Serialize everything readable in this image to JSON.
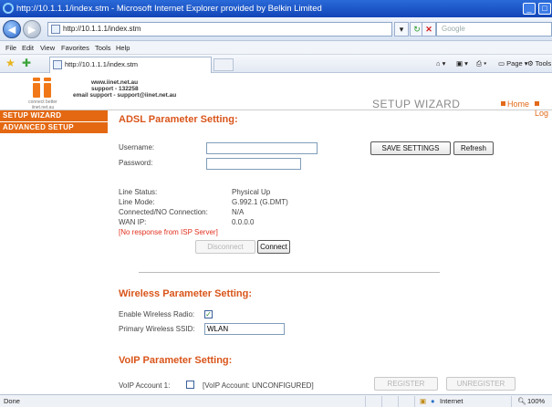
{
  "window": {
    "title": "http://10.1.1.1/index.stm - Microsoft Internet Explorer provided by Belkin Limited",
    "controls": [
      "_",
      "□"
    ]
  },
  "browser": {
    "address": "http://10.1.1.1/index.stm",
    "search_placeholder": "Google",
    "menu": [
      "File",
      "Edit",
      "View",
      "Favorites",
      "Tools",
      "Help"
    ],
    "tab_title": "http://10.1.1.1/index.stm",
    "commands": {
      "page": "Page",
      "tools": "Tools"
    },
    "status_left": "Done",
    "zone": "Internet",
    "zoom": "100%"
  },
  "header": {
    "logo_tagline_1": "connect better",
    "logo_tagline_2": "iinet.net.au",
    "site": "www.iinet.net.au",
    "support": "support - 132258",
    "email": "email support - support@iinet.net.au",
    "wizard_title": "SETUP WIZARD",
    "home_link": "Home",
    "logout_link": "Log"
  },
  "sidebar": {
    "items": [
      "SETUP WIZARD",
      "ADVANCED SETUP"
    ]
  },
  "adsl": {
    "heading": "ADSL Parameter Setting:",
    "username_label": "Username:",
    "password_label": "Password:",
    "username_value": "",
    "password_value": "",
    "save_button": "SAVE SETTINGS",
    "refresh_button": "Refresh",
    "status_rows": [
      {
        "label": "Line Status:",
        "value": "Physical Up"
      },
      {
        "label": "Line Mode:",
        "value": "G.992.1 (G.DMT)"
      },
      {
        "label": "Connected/NO Connection:",
        "value": "N/A"
      },
      {
        "label": "WAN IP:",
        "value": "0.0.0.0"
      }
    ],
    "error": "[No response from ISP Server]",
    "disconnect_button": "Disconnect",
    "connect_button": "Connect"
  },
  "wireless": {
    "heading": "Wireless Parameter Setting:",
    "enable_label": "Enable Wireless Radio:",
    "enable_checked": "✓",
    "ssid_label": "Primary Wireless SSID:",
    "ssid_value": "WLAN"
  },
  "voip": {
    "heading": "VoIP Parameter Setting:",
    "account_label": "VoIP Account 1:",
    "account_status": "[VoIP Account: UNCONFIGURED]",
    "register_button": "REGISTER",
    "unregister_button": "UNREGISTER"
  }
}
